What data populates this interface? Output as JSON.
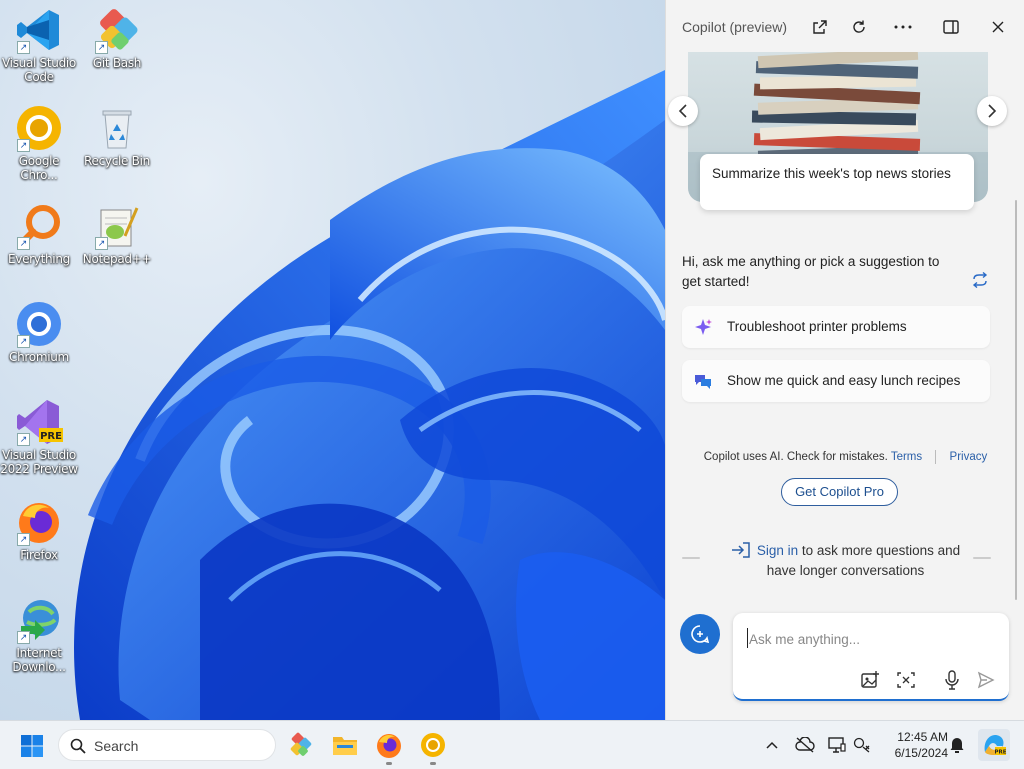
{
  "desktop": {
    "icons": [
      {
        "label": "Visual Studio Code"
      },
      {
        "label": "Git Bash"
      },
      {
        "label": "Google Chro..."
      },
      {
        "label": "Recycle Bin"
      },
      {
        "label": "Everything"
      },
      {
        "label": "Notepad++"
      },
      {
        "label": "Chromium"
      },
      {
        "label": "Visual Studio 2022 Preview"
      },
      {
        "label": "Firefox"
      },
      {
        "label": "Internet Downlo..."
      }
    ]
  },
  "copilot": {
    "title": "Copilot (preview)",
    "suggestion_card": "Summarize this week's top news stories",
    "greeting": "Hi, ask me anything or pick a suggestion to get started!",
    "chips": [
      {
        "label": "Troubleshoot printer problems",
        "icon": "sparkle-icon"
      },
      {
        "label": "Show me quick and easy lunch recipes",
        "icon": "chat-bubbles-icon"
      }
    ],
    "disclaimer": {
      "text": "Copilot uses AI. Check for mistakes.",
      "terms": "Terms",
      "privacy": "Privacy"
    },
    "pro_button": "Get Copilot Pro",
    "signin": {
      "link": "Sign in",
      "text_1": " to ask more questions and",
      "text_2": "have longer conversations"
    },
    "composer": {
      "placeholder": "Ask me anything..."
    }
  },
  "taskbar": {
    "search_placeholder": "Search",
    "clock": {
      "time": "12:45 AM",
      "date": "6/15/2024"
    }
  },
  "colors": {
    "accent": "#1f6fd0",
    "link": "#2a5fa8"
  }
}
